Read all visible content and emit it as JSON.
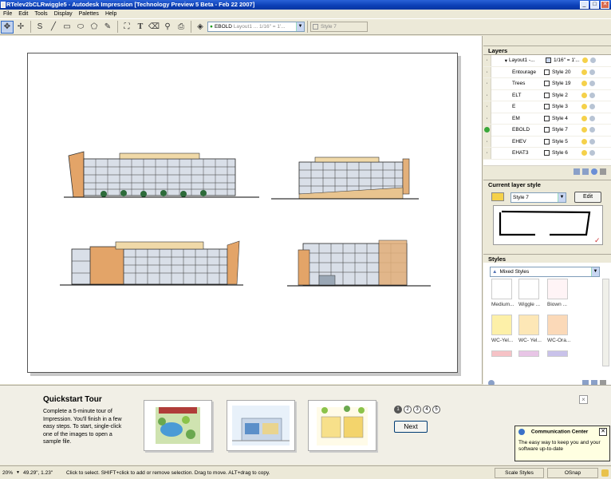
{
  "window": {
    "title": "RTelev2bCLRwiggle5 - Autodesk Impression [Technology Preview 5 Beta - Feb 22 2007]"
  },
  "menu": [
    "File",
    "Edit",
    "Tools",
    "Display",
    "Palettes",
    "Help"
  ],
  "toolbar": {
    "layer_combo": "EBOLD",
    "layer_combo_rest": "Layout1 ... 1/16\" = 1'...",
    "style_combo": "Style 7"
  },
  "layers": {
    "title": "Layers",
    "root": {
      "name": "Layout1 -...",
      "scale": "1/16\" = 1'..."
    },
    "rows": [
      {
        "name": "Entourage",
        "style": "Style 20",
        "active": false
      },
      {
        "name": "Trees",
        "style": "Style 19",
        "active": false
      },
      {
        "name": "ELT",
        "style": "Style 2",
        "active": false
      },
      {
        "name": "E",
        "style": "Style 3",
        "active": false
      },
      {
        "name": "EM",
        "style": "Style 4",
        "active": false
      },
      {
        "name": "EBOLD",
        "style": "Style 7",
        "active": true
      },
      {
        "name": "EHEV",
        "style": "Style 5",
        "active": false
      },
      {
        "name": "EHAT3",
        "style": "Style 6",
        "active": false
      }
    ]
  },
  "current_style": {
    "title": "Current layer style",
    "style": "Style 7",
    "edit_label": "Edit"
  },
  "styles": {
    "title": "Styles",
    "filter": "Mixed Styles",
    "items": [
      {
        "label": "Medium...",
        "color": "#ffffff"
      },
      {
        "label": "Wiggle ...",
        "color": "#ffffff"
      },
      {
        "label": "Biown ...",
        "color": "#fff4f6"
      },
      {
        "label": "WC-Yel...",
        "color": "#fdf0a8"
      },
      {
        "label": "WC- Yel...",
        "color": "#fde7b6"
      },
      {
        "label": "WC-Ora...",
        "color": "#fbd9b8"
      }
    ],
    "partial_colors": [
      "#f6c2c6",
      "#e8c5e6",
      "#c9c2ea"
    ]
  },
  "tour": {
    "title": "Quickstart Tour",
    "body": "Complete a 5-minute tour of Impression. You'll finish in a few easy steps. To start, single-click one of the images to open a sample file.",
    "pages": [
      "1",
      "2",
      "3",
      "4",
      "5"
    ],
    "next_label": "Next"
  },
  "comm": {
    "title": "Communication Center",
    "body": "The easy way to keep you and your software up-to-date"
  },
  "status": {
    "zoom": "20%",
    "coords": "49.29\", 1.23\"",
    "hint": "Click to select. SHIFT+click to add or remove selection. Drag to move. ALT+drag to copy.",
    "scale_styles": "Scale Styles",
    "osnap": "OSnap"
  }
}
